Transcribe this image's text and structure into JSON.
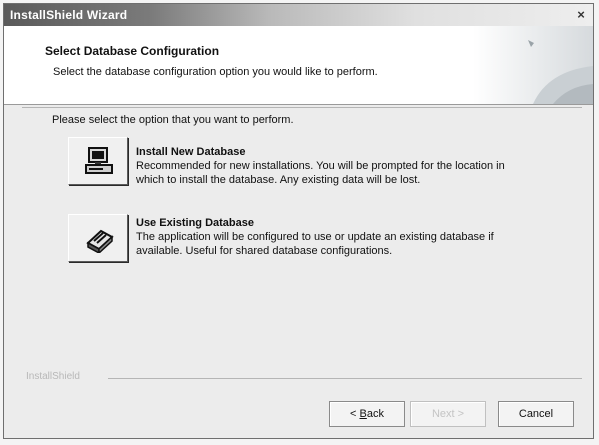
{
  "window": {
    "title": "InstallShield Wizard"
  },
  "header": {
    "title": "Select Database Configuration",
    "subtitle": "Select the database configuration option you would like to perform."
  },
  "content": {
    "prompt": "Please select the option that you want to perform.",
    "options": [
      {
        "icon": "computer-icon",
        "title": "Install New Database",
        "description_line1": "Recommended for new installations.  You will be prompted for the location in",
        "description_line2": "which to install the database.  Any existing data will be lost."
      },
      {
        "icon": "database-book-icon",
        "title": "Use Existing Database",
        "description_line1": "The application will be configured to use or update an existing database if",
        "description_line2": "available.  Useful for shared database configurations."
      }
    ]
  },
  "footer": {
    "brand": "InstallShield",
    "back_label_mnemonic": "B",
    "back_label_rest": "ack",
    "back_prefix": "< ",
    "next_label": "Next >",
    "cancel_label": "Cancel"
  }
}
